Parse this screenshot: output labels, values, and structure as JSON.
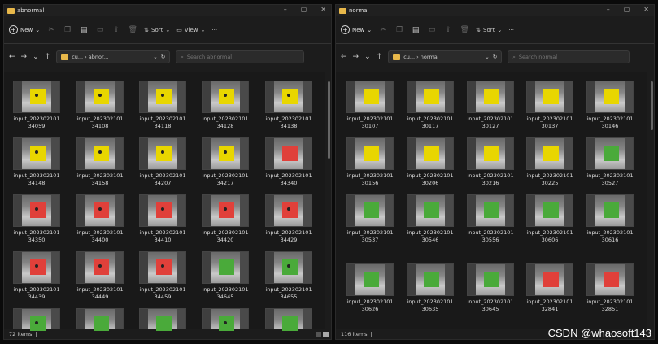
{
  "left": {
    "title": "abnormal",
    "new_label": "New",
    "sort_label": "Sort",
    "view_label": "View",
    "more_label": "···",
    "address": "cu...  ›  abnor...",
    "search_placeholder": "Search abnormal",
    "status": "72 items",
    "files": [
      {
        "l1": "input_202302101",
        "l2": "34059",
        "color": "#e8d600",
        "dot": true
      },
      {
        "l1": "input_202302101",
        "l2": "34108",
        "color": "#e8d600",
        "dot": true
      },
      {
        "l1": "input_202302101",
        "l2": "34118",
        "color": "#e8d600",
        "dot": true
      },
      {
        "l1": "input_202302101",
        "l2": "34128",
        "color": "#e8d600",
        "dot": true
      },
      {
        "l1": "input_202302101",
        "l2": "34138",
        "color": "#e8d600",
        "dot": true
      },
      {
        "l1": "input_202302101",
        "l2": "34148",
        "color": "#e8d600",
        "dot": true
      },
      {
        "l1": "input_202302101",
        "l2": "34158",
        "color": "#e8d600",
        "dot": true
      },
      {
        "l1": "input_202302101",
        "l2": "34207",
        "color": "#e8d600",
        "dot": true
      },
      {
        "l1": "input_202302101",
        "l2": "34217",
        "color": "#e8d600",
        "dot": true
      },
      {
        "l1": "input_202302101",
        "l2": "34340",
        "color": "#e0403a",
        "dot": false
      },
      {
        "l1": "input_202302101",
        "l2": "34350",
        "color": "#e0403a",
        "dot": true
      },
      {
        "l1": "input_202302101",
        "l2": "34400",
        "color": "#e0403a",
        "dot": true
      },
      {
        "l1": "input_202302101",
        "l2": "34410",
        "color": "#e0403a",
        "dot": true
      },
      {
        "l1": "input_202302101",
        "l2": "34420",
        "color": "#e0403a",
        "dot": true
      },
      {
        "l1": "input_202302101",
        "l2": "34429",
        "color": "#e0403a",
        "dot": true
      },
      {
        "l1": "input_202302101",
        "l2": "34439",
        "color": "#e0403a",
        "dot": true
      },
      {
        "l1": "input_202302101",
        "l2": "34449",
        "color": "#e0403a",
        "dot": true
      },
      {
        "l1": "input_202302101",
        "l2": "34459",
        "color": "#e0403a",
        "dot": true
      },
      {
        "l1": "input_202302101",
        "l2": "34645",
        "color": "#4aaa3a",
        "dot": false
      },
      {
        "l1": "input_202302101",
        "l2": "34655",
        "color": "#4aaa3a",
        "dot": true
      },
      {
        "l1": "",
        "l2": "",
        "color": "#4aaa3a",
        "dot": true
      },
      {
        "l1": "",
        "l2": "",
        "color": "#4aaa3a",
        "dot": false
      },
      {
        "l1": "",
        "l2": "",
        "color": "#4aaa3a",
        "dot": false
      },
      {
        "l1": "",
        "l2": "",
        "color": "#4aaa3a",
        "dot": true
      },
      {
        "l1": "",
        "l2": "",
        "color": "#4aaa3a",
        "dot": false
      }
    ]
  },
  "right": {
    "title": "normal",
    "new_label": "New",
    "sort_label": "Sort",
    "more_label": "···",
    "address": "cu...  ›  normal",
    "search_placeholder": "Search normal",
    "status": "116 items",
    "files": [
      {
        "l1": "input_202302101",
        "l2": "30107",
        "color": "#e8d600"
      },
      {
        "l1": "input_202302101",
        "l2": "30117",
        "color": "#e8d600"
      },
      {
        "l1": "input_202302101",
        "l2": "30127",
        "color": "#e8d600"
      },
      {
        "l1": "input_202302101",
        "l2": "30137",
        "color": "#e8d600"
      },
      {
        "l1": "input_202302101",
        "l2": "30146",
        "color": "#e8d600"
      },
      {
        "l1": "input_202302101",
        "l2": "30156",
        "color": "#e8d600"
      },
      {
        "l1": "input_202302101",
        "l2": "30206",
        "color": "#e8d600"
      },
      {
        "l1": "input_202302101",
        "l2": "30216",
        "color": "#e8d600"
      },
      {
        "l1": "input_202302101",
        "l2": "30225",
        "color": "#e8d600"
      },
      {
        "l1": "input_202302101",
        "l2": "30527",
        "color": "#4aaa3a"
      },
      {
        "l1": "input_202302101",
        "l2": "30537",
        "color": "#4aaa3a"
      },
      {
        "l1": "input_202302101",
        "l2": "30546",
        "color": "#4aaa3a"
      },
      {
        "l1": "input_202302101",
        "l2": "30556",
        "color": "#4aaa3a"
      },
      {
        "l1": "input_202302101",
        "l2": "30606",
        "color": "#4aaa3a"
      },
      {
        "l1": "input_202302101",
        "l2": "30616",
        "color": "#4aaa3a"
      },
      {
        "l1": "input_202302101",
        "l2": "30626",
        "color": "#4aaa3a"
      },
      {
        "l1": "input_202302101",
        "l2": "30635",
        "color": "#4aaa3a"
      },
      {
        "l1": "input_202302101",
        "l2": "30645",
        "color": "#4aaa3a"
      },
      {
        "l1": "input_202302101",
        "l2": "32841",
        "color": "#e0403a"
      },
      {
        "l1": "input_202302101",
        "l2": "32851",
        "color": "#e0403a"
      }
    ]
  },
  "watermark": "CSDN @whaosoft143"
}
